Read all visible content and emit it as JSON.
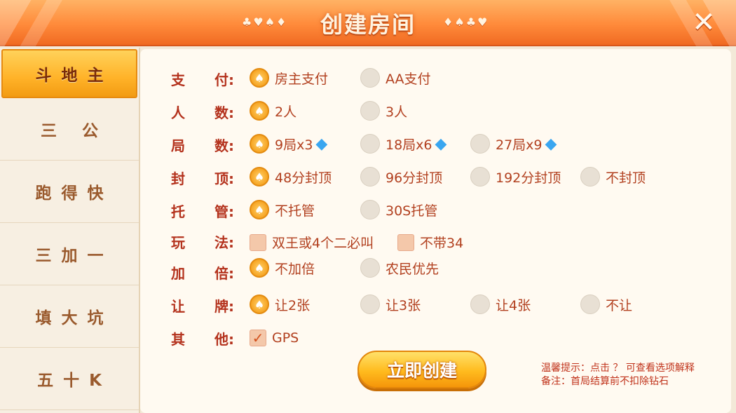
{
  "header": {
    "title": "创建房间",
    "suits_left": "♣♥♠♦",
    "suits_right": "♦♠♣♥",
    "close_symbol": "✕"
  },
  "sidebar": {
    "items": [
      {
        "label": "斗地主",
        "active": true
      },
      {
        "label": "三 公",
        "active": false
      },
      {
        "label": "跑得快",
        "active": false
      },
      {
        "label": "三加一",
        "active": false
      },
      {
        "label": "填大坑",
        "active": false
      },
      {
        "label": "五十K",
        "active": false
      }
    ]
  },
  "rows": {
    "pay": {
      "label": [
        "支",
        "付:"
      ],
      "options": [
        "房主支付",
        "AA支付"
      ]
    },
    "players": {
      "label": [
        "人",
        "数:"
      ],
      "options": [
        "2人",
        "3人"
      ]
    },
    "rounds": {
      "label": [
        "局",
        "数:"
      ],
      "options": [
        "9局x3",
        "18局x6",
        "27局x9"
      ]
    },
    "cap": {
      "label": [
        "封",
        "顶:"
      ],
      "options": [
        "48分封顶",
        "96分封顶",
        "192分封顶",
        "不封顶"
      ]
    },
    "auto": {
      "label": [
        "托",
        "管:"
      ],
      "options": [
        "不托管",
        "30S托管"
      ]
    },
    "rules": {
      "label": [
        "玩",
        "法:"
      ],
      "options": [
        "双王或4个二必叫",
        "不带34"
      ]
    },
    "double": {
      "label": [
        "加",
        "倍:"
      ],
      "options": [
        "不加倍",
        "农民优先"
      ]
    },
    "concede": {
      "label": [
        "让",
        "牌:"
      ],
      "options": [
        "让2张",
        "让3张",
        "让4张",
        "不让"
      ]
    },
    "other": {
      "label": [
        "其",
        "他:"
      ],
      "options": [
        "GPS"
      ]
    }
  },
  "create_button": "立即创建",
  "hint": {
    "line1": "温馨提示：点击 ？ 可查看选项解释",
    "line2": "备注：首局结算前不扣除钻石"
  },
  "colors": {
    "accent": "#ff8a3a",
    "label_red": "#b4321d",
    "button_gold": "#ffbb1e",
    "gem_blue": "#3aa6f0"
  }
}
